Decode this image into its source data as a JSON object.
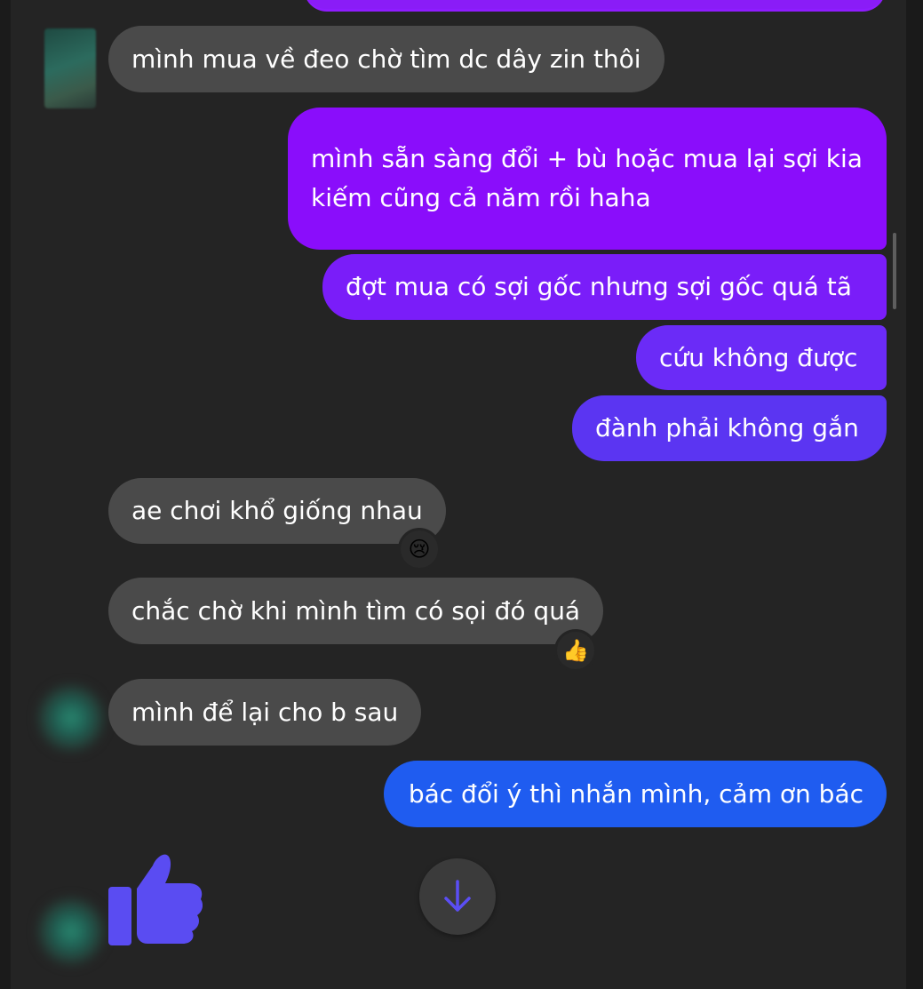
{
  "messages": [
    {
      "side": "in",
      "text": "mình mua về đeo chờ tìm dc dây zin thôi"
    },
    {
      "side": "out",
      "lines": [
        "mình sẵn sàng đổi + bù hoặc mua lại sợi kia",
        "kiếm cũng cả năm rồi haha"
      ]
    },
    {
      "side": "out",
      "text": "đợt mua có sợi gốc nhưng sợi gốc quá tã"
    },
    {
      "side": "out",
      "text": "cứu không được"
    },
    {
      "side": "out",
      "text": "đành phải không gắn"
    },
    {
      "side": "in",
      "text": "ae chơi khổ giống nhau",
      "reaction": "😢"
    },
    {
      "side": "in",
      "text": "chắc chờ khi mình tìm có sọi đó quá",
      "reaction": "👍"
    },
    {
      "side": "in",
      "text": "mình để lại cho b sau"
    },
    {
      "side": "out",
      "text": "bác đổi ý thì nhắn mình, cảm ơn bác"
    }
  ],
  "icons": {
    "like": "thumbs-up-icon",
    "scroll_down": "arrow-down-icon"
  },
  "colors": {
    "background": "#242424",
    "incoming_bubble": "#4a4a4a",
    "outgoing_gradient": [
      "#8a0dfb",
      "#7a1df9",
      "#6b2bf7",
      "#5b35f2",
      "#1f5cf0"
    ],
    "like_icon": "#5a4cf2"
  }
}
